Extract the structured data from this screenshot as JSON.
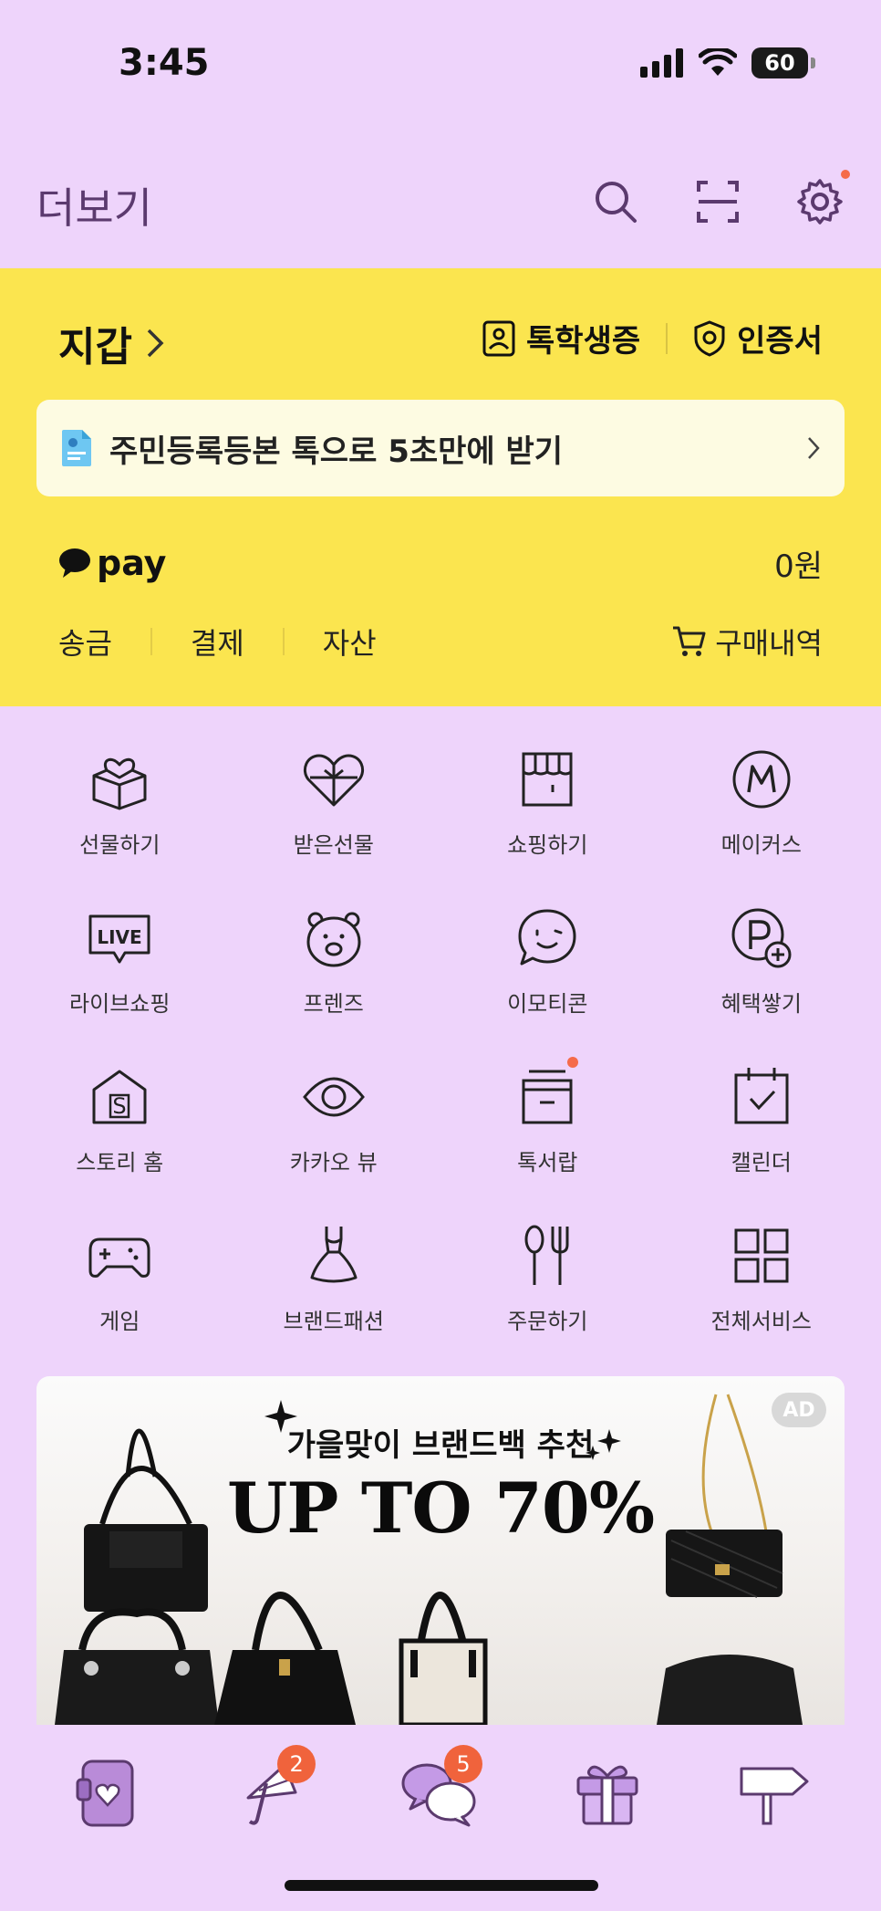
{
  "status_bar": {
    "time": "3:45",
    "battery": "60"
  },
  "header": {
    "title": "더보기"
  },
  "wallet": {
    "title": "지갑",
    "links": [
      {
        "label": "톡학생증"
      },
      {
        "label": "인증서"
      }
    ],
    "doc_banner": "주민등록등본 톡으로 5초만에 받기",
    "pay_logo": "pay",
    "pay_amount": "0원",
    "pay_menu": [
      "송금",
      "결제",
      "자산"
    ],
    "purchase_label": "구매내역"
  },
  "services": [
    {
      "label": "선물하기",
      "icon": "gift-box-icon"
    },
    {
      "label": "받은선물",
      "icon": "heart-gift-icon"
    },
    {
      "label": "쇼핑하기",
      "icon": "store-icon"
    },
    {
      "label": "메이커스",
      "icon": "makers-icon"
    },
    {
      "label": "라이브쇼핑",
      "icon": "live-icon"
    },
    {
      "label": "프렌즈",
      "icon": "friends-icon"
    },
    {
      "label": "이모티콘",
      "icon": "emoticon-icon"
    },
    {
      "label": "혜택쌓기",
      "icon": "points-icon"
    },
    {
      "label": "스토리 홈",
      "icon": "story-home-icon"
    },
    {
      "label": "카카오 뷰",
      "icon": "view-icon"
    },
    {
      "label": "톡서랍",
      "icon": "drawer-icon"
    },
    {
      "label": "캘린더",
      "icon": "calendar-icon"
    },
    {
      "label": "게임",
      "icon": "game-icon"
    },
    {
      "label": "브랜드패션",
      "icon": "dress-icon"
    },
    {
      "label": "주문하기",
      "icon": "fork-knife-icon"
    },
    {
      "label": "전체서비스",
      "icon": "grid-icon"
    }
  ],
  "ad": {
    "badge": "AD",
    "subtitle": "가을맞이 브랜드백 추천",
    "headline": "UP TO 70%"
  },
  "bottom_nav": [
    {
      "icon": "wallet-nav-icon",
      "badge": ""
    },
    {
      "icon": "umbrella-nav-icon",
      "badge": "2"
    },
    {
      "icon": "chat-nav-icon",
      "badge": "5"
    },
    {
      "icon": "gift-nav-icon",
      "badge": ""
    },
    {
      "icon": "signpost-nav-icon",
      "badge": ""
    }
  ],
  "colors": {
    "background": "#eed4fb",
    "wallet_yellow": "#fbe54f",
    "badge": "#f0633c",
    "header_text": "#5b3a6e"
  }
}
